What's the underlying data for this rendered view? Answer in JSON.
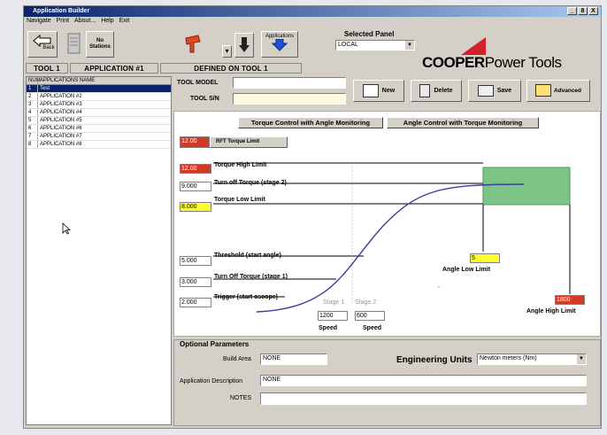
{
  "window": {
    "title": "Application Builder",
    "controls": [
      "_",
      "8",
      "X"
    ]
  },
  "menu": [
    "Navigate",
    "Print",
    "About...",
    "Help",
    "Exit"
  ],
  "toolbar": {
    "back_label": "Back",
    "no_stations_label": "No Stations",
    "applications_label": "Applications",
    "dropdown_arrow": "▾"
  },
  "status_bar": {
    "tool": "TOOL 1",
    "application": "APPLICATION #1",
    "defined": "DEFINED ON TOOL 1"
  },
  "selected_panel": {
    "label": "Selected Panel",
    "value": "LOCAL"
  },
  "brand": {
    "name_bold": "COOPER",
    "name_light": "Power Tools",
    "color": "#d4202a"
  },
  "tool_info": {
    "model_label": "TOOL MODEL",
    "model_value": "",
    "serial_label": "TOOL S/N",
    "serial_value": ""
  },
  "actions": [
    {
      "label": "New",
      "icon": "new-file-icon"
    },
    {
      "label": "Delete",
      "icon": "trash-icon"
    },
    {
      "label": "Save",
      "icon": "save-icon"
    },
    {
      "label": "Advanced",
      "icon": "advanced-icon"
    }
  ],
  "list": {
    "headers": [
      "NUM",
      "APPLICATIONS NAME"
    ],
    "rows": [
      {
        "num": "1",
        "name": "Test",
        "selected": true
      },
      {
        "num": "2",
        "name": "APPLICATION #2"
      },
      {
        "num": "3",
        "name": "APPLICATION #3"
      },
      {
        "num": "4",
        "name": "APPLICATION #4"
      },
      {
        "num": "5",
        "name": "APPLICATION #5"
      },
      {
        "num": "6",
        "name": "APPLICATION #6"
      },
      {
        "num": "7",
        "name": "APPLICATION #7"
      },
      {
        "num": "8",
        "name": "APPLICATION #8"
      }
    ]
  },
  "modes": {
    "torque": "Torque Control with Angle Monitoring",
    "angle": "Angle Control with Torque Monitoring"
  },
  "parameters": {
    "rft_value": "12.00",
    "rft_label": "RFT Torque Limit",
    "high_value": "12.00",
    "high_label": "Torque High Limit",
    "turnoff2_value": "9.000",
    "turnoff2_label": "Turn off Torque (stage 2)",
    "low_value": "8.000",
    "low_label": "Torque Low Limit",
    "threshold_value": "5.000",
    "threshold_label": "Threshold (start angle)",
    "turnoff1_value": "3.000",
    "turnoff1_label": "Turn Off Torque (stage 1)",
    "trigger_value": "2.000",
    "trigger_label": "Trigger (start oscope)",
    "angle_low_value": "5",
    "angle_low_label": "Angle Low Limit",
    "angle_high_value": "1800",
    "angle_high_label": "Angle High Limit",
    "stage1_label": "Stage 1",
    "stage1_speed": "1200",
    "stage2_label": "Stage 2",
    "stage2_speed": "600",
    "speed_label": "Speed"
  },
  "optional": {
    "title": "Optional Parameters",
    "build_area_label": "Build Area",
    "build_area_value": "NONE",
    "units_label": "Engineering Units",
    "units_value": "Newton meters (Nm)",
    "desc_label": "Application Description",
    "desc_value": "NONE",
    "notes_label": "NOTES",
    "notes_value": ""
  },
  "colors": {
    "red": "#d23a26",
    "yellow": "#ffff30",
    "green": "#7dc487",
    "curve": "#3b3f9e",
    "title_bar": "#0a246a"
  }
}
